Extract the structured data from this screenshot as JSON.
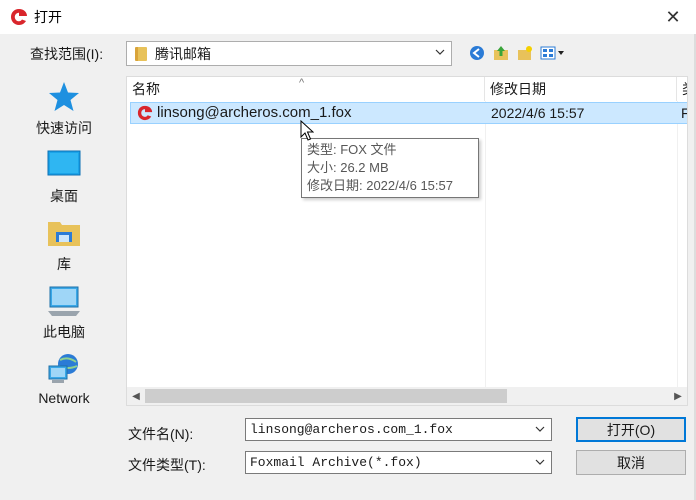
{
  "window": {
    "title": "打开",
    "close_glyph": "✕"
  },
  "lookin": {
    "label": "查找范围(I):",
    "value": "腾讯邮箱"
  },
  "places": [
    {
      "label": "快速访问",
      "icon": "star-icon"
    },
    {
      "label": "桌面",
      "icon": "desktop-icon"
    },
    {
      "label": "库",
      "icon": "library-icon"
    },
    {
      "label": "此电脑",
      "icon": "computer-icon"
    },
    {
      "label": "Network",
      "icon": "network-icon"
    }
  ],
  "filelist": {
    "columns": [
      {
        "label": "名称"
      },
      {
        "label": "修改日期"
      },
      {
        "label": "类"
      }
    ],
    "sort_glyph": "^",
    "rows": [
      {
        "name": "linsong@archeros.com_1.fox",
        "date": "2022/4/6 15:57",
        "type": "F",
        "selected": true
      }
    ]
  },
  "tooltip": {
    "lines": [
      "类型: FOX 文件",
      "大小: 26.2 MB",
      "修改日期: 2022/4/6 15:57"
    ]
  },
  "filename": {
    "label": "文件名(N):",
    "value": "linsong@archeros.com_1.fox"
  },
  "filetype": {
    "label": "文件类型(T):",
    "value": "Foxmail Archive(*.fox)"
  },
  "buttons": {
    "open": "打开(O)",
    "cancel": "取消"
  },
  "colors": {
    "accent": "#0078d7",
    "selection": "#cce8ff",
    "brand_red": "#d9262c"
  }
}
